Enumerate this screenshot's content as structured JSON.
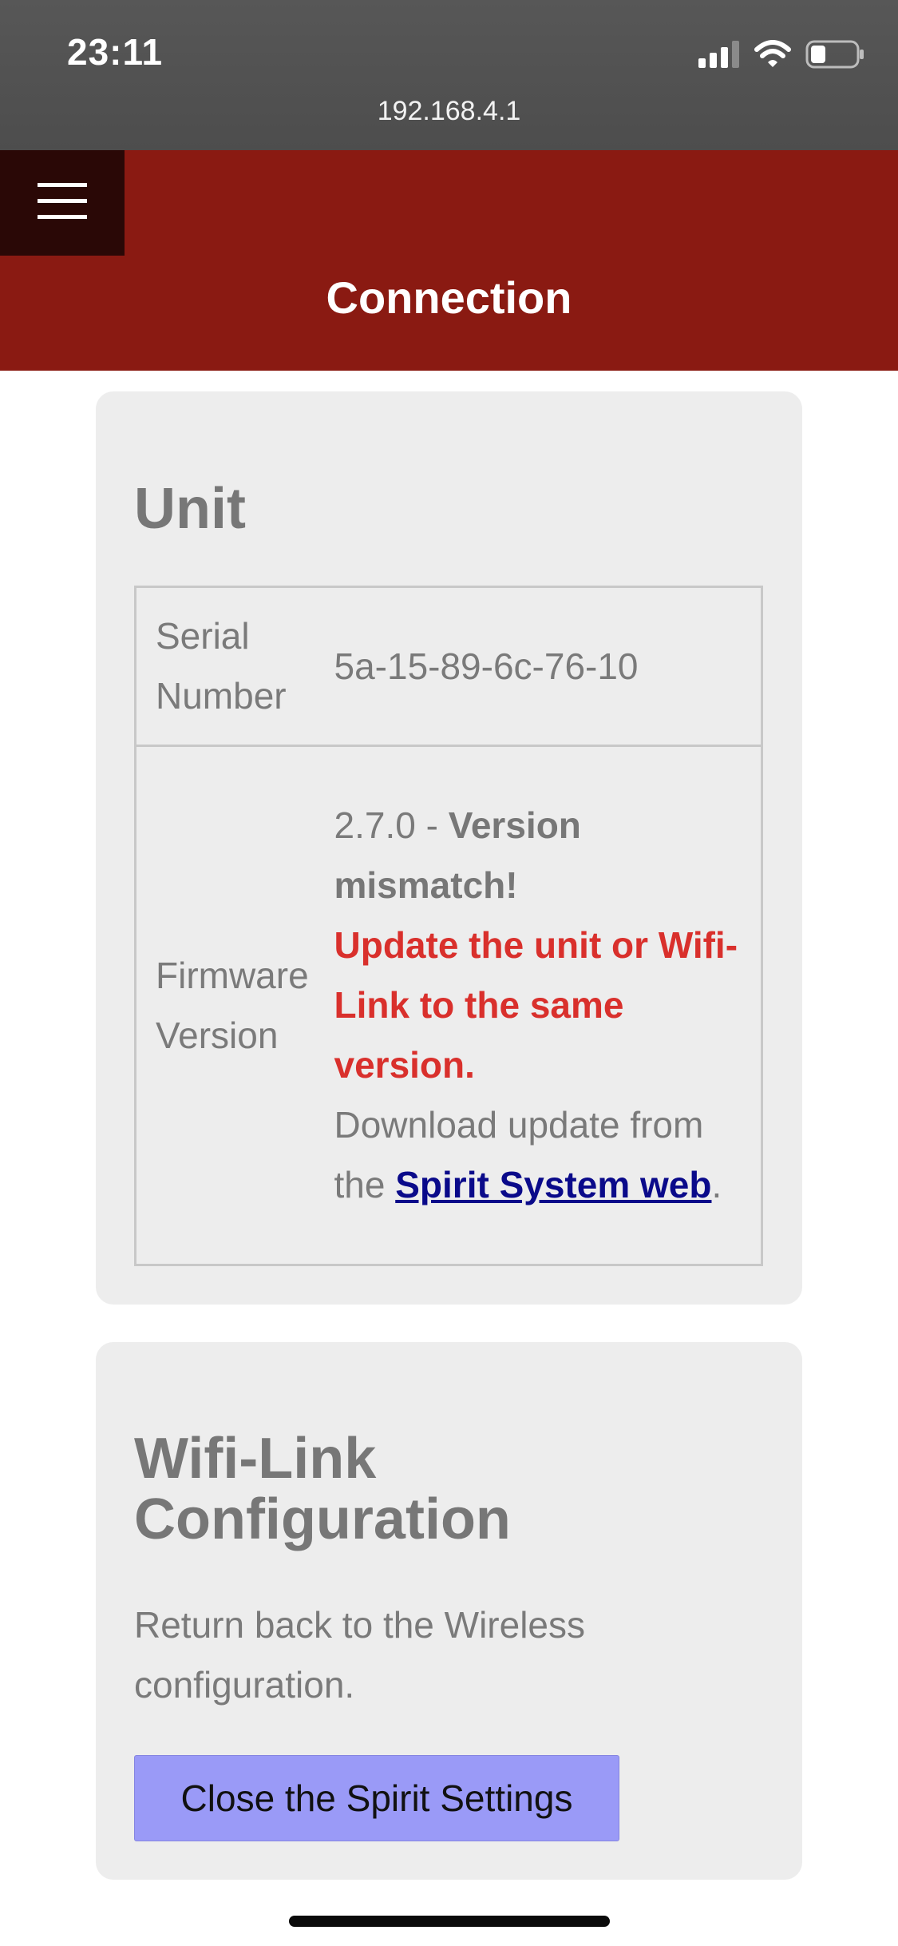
{
  "status_bar": {
    "time": "23:11",
    "url": "192.168.4.1",
    "icons": [
      "signal-icon",
      "wifi-icon",
      "battery-icon"
    ]
  },
  "header": {
    "title": "Connection",
    "menu_icon": "hamburger-menu-icon",
    "background_color": "#8a1a12"
  },
  "unit_card": {
    "heading": "Unit",
    "serial_label": "Serial Number",
    "serial_value": "5a-15-89-6c-76-10",
    "firmware_label": "Firmware Version",
    "firmware_version": "2.7.0",
    "firmware_separator": " - ",
    "mismatch_text": "Version mismatch!",
    "warning_text": "Update the unit or Wifi-Link to the same version.",
    "download_prefix": "Download update from the ",
    "download_link": "Spirit System web",
    "download_suffix": "."
  },
  "wifi_card": {
    "heading": "Wifi-Link Configuration",
    "description": "Return back to the Wireless configuration.",
    "button_label": "Close the Spirit Settings",
    "button_color": "#9a9af7"
  },
  "colors": {
    "warning": "#d9302c",
    "link": "#0a0a8a",
    "text": "#7a7a7a"
  }
}
